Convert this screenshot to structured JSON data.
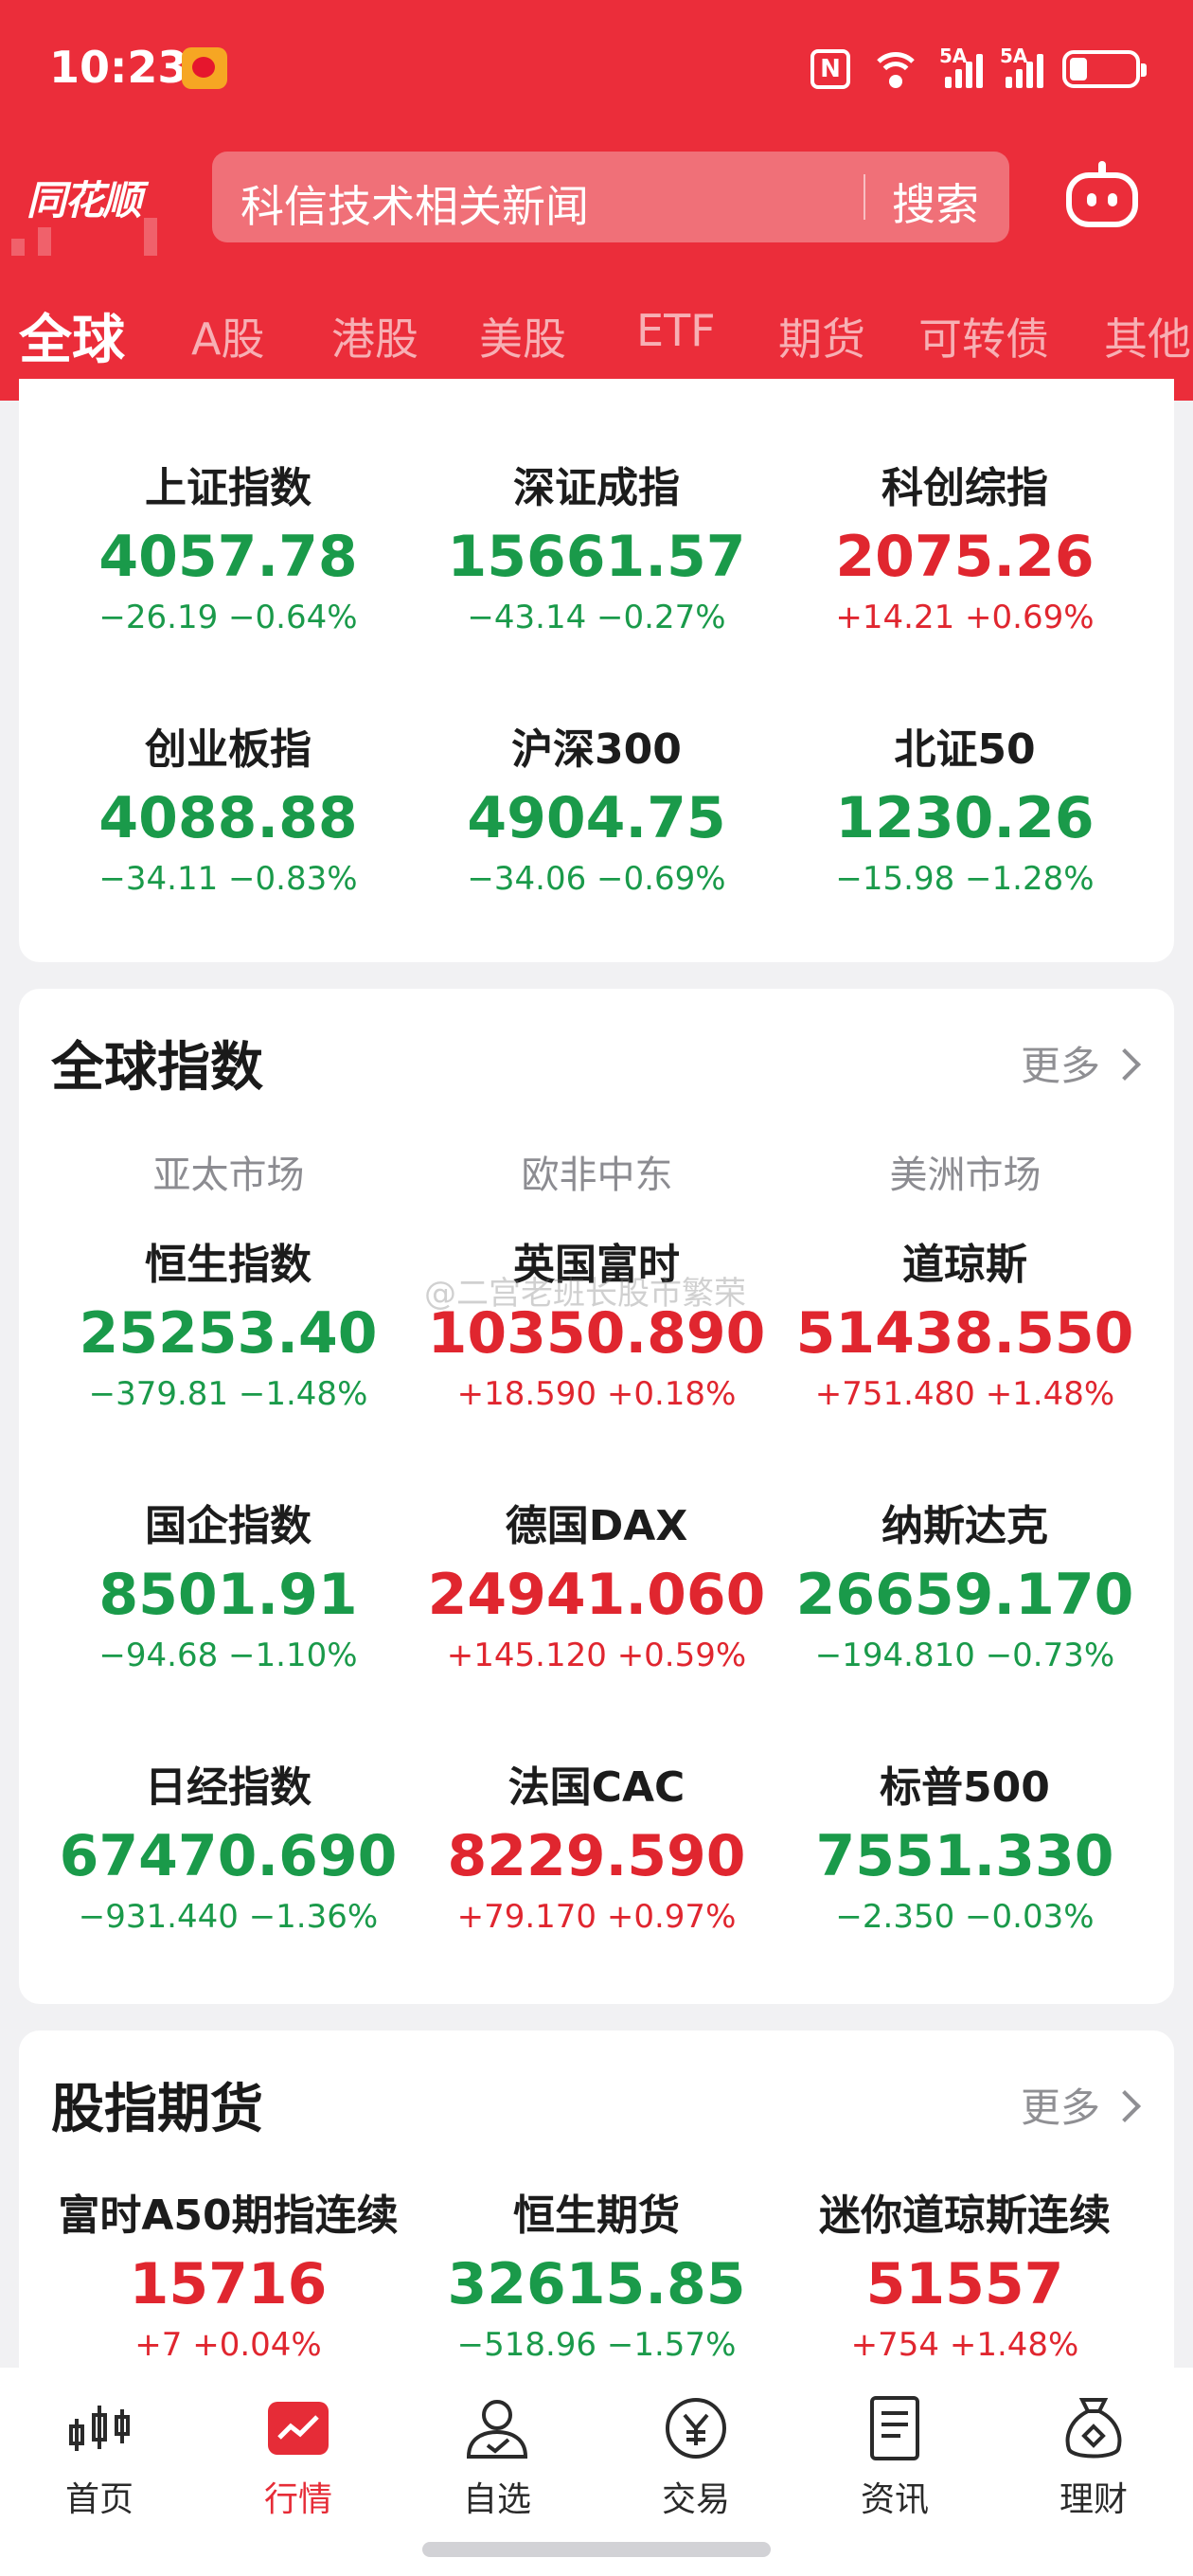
{
  "status_bar": {
    "time": "10:23",
    "signal1": "5A",
    "signal2": "5A"
  },
  "app": {
    "logo": "同花顺"
  },
  "search": {
    "text": "科信技术相关新闻",
    "button": "搜索"
  },
  "tabs": [
    "全球",
    "A股",
    "港股",
    "美股",
    "ETF",
    "期货",
    "可转债",
    "其他"
  ],
  "domestic": [
    {
      "name": "上证指数",
      "price": "4057.78",
      "change": "−26.19  −0.64%",
      "dir": "dn"
    },
    {
      "name": "深证成指",
      "price": "15661.57",
      "change": "−43.14  −0.27%",
      "dir": "dn"
    },
    {
      "name": "科创综指",
      "price": "2075.26",
      "change": "+14.21  +0.69%",
      "dir": "up"
    },
    {
      "name": "创业板指",
      "price": "4088.88",
      "change": "−34.11  −0.83%",
      "dir": "dn"
    },
    {
      "name": "沪深300",
      "price": "4904.75",
      "change": "−34.06  −0.69%",
      "dir": "dn"
    },
    {
      "name": "北证50",
      "price": "1230.26",
      "change": "−15.98  −1.28%",
      "dir": "dn"
    }
  ],
  "global": {
    "title": "全球指数",
    "more": "更多",
    "regions": [
      "亚太市场",
      "欧非中东",
      "美洲市场"
    ],
    "items": [
      {
        "name": "恒生指数",
        "price": "25253.40",
        "change": "−379.81  −1.48%",
        "dir": "dn"
      },
      {
        "name": "英国富时",
        "price": "10350.890",
        "change": "+18.590  +0.18%",
        "dir": "up"
      },
      {
        "name": "道琼斯",
        "price": "51438.550",
        "change": "+751.480  +1.48%",
        "dir": "up"
      },
      {
        "name": "国企指数",
        "price": "8501.91",
        "change": "−94.68  −1.10%",
        "dir": "dn"
      },
      {
        "name": "德国DAX",
        "price": "24941.060",
        "change": "+145.120  +0.59%",
        "dir": "up"
      },
      {
        "name": "纳斯达克",
        "price": "26659.170",
        "change": "−194.810  −0.73%",
        "dir": "dn"
      },
      {
        "name": "日经指数",
        "price": "67470.690",
        "change": "−931.440  −1.36%",
        "dir": "dn"
      },
      {
        "name": "法国CAC",
        "price": "8229.590",
        "change": "+79.170  +0.97%",
        "dir": "up"
      },
      {
        "name": "标普500",
        "price": "7551.330",
        "change": "−2.350  −0.03%",
        "dir": "dn"
      }
    ]
  },
  "futures": {
    "title": "股指期货",
    "more": "更多",
    "items": [
      {
        "name": "富时A50期指连续",
        "price": "15716",
        "change": "+7  +0.04%",
        "dir": "up"
      },
      {
        "name": "恒生期货",
        "price": "32615.85",
        "change": "−518.96  −1.57%",
        "dir": "dn"
      },
      {
        "name": "迷你道琼斯连续",
        "price": "51557",
        "change": "+754  +1.48%",
        "dir": "up"
      }
    ]
  },
  "watermark": "@二宫老班长股市繁荣",
  "bottom_nav": [
    {
      "label": "首页",
      "icon": "candlestick-icon"
    },
    {
      "label": "行情",
      "icon": "market-chart-icon"
    },
    {
      "label": "自选",
      "icon": "user-check-icon"
    },
    {
      "label": "交易",
      "icon": "yen-coin-icon"
    },
    {
      "label": "资讯",
      "icon": "news-doc-icon"
    },
    {
      "label": "理财",
      "icon": "money-bag-icon"
    }
  ],
  "colors": {
    "brand_red": "#eb2d3a",
    "up": "#e0262f",
    "down": "#1a9a4a"
  }
}
